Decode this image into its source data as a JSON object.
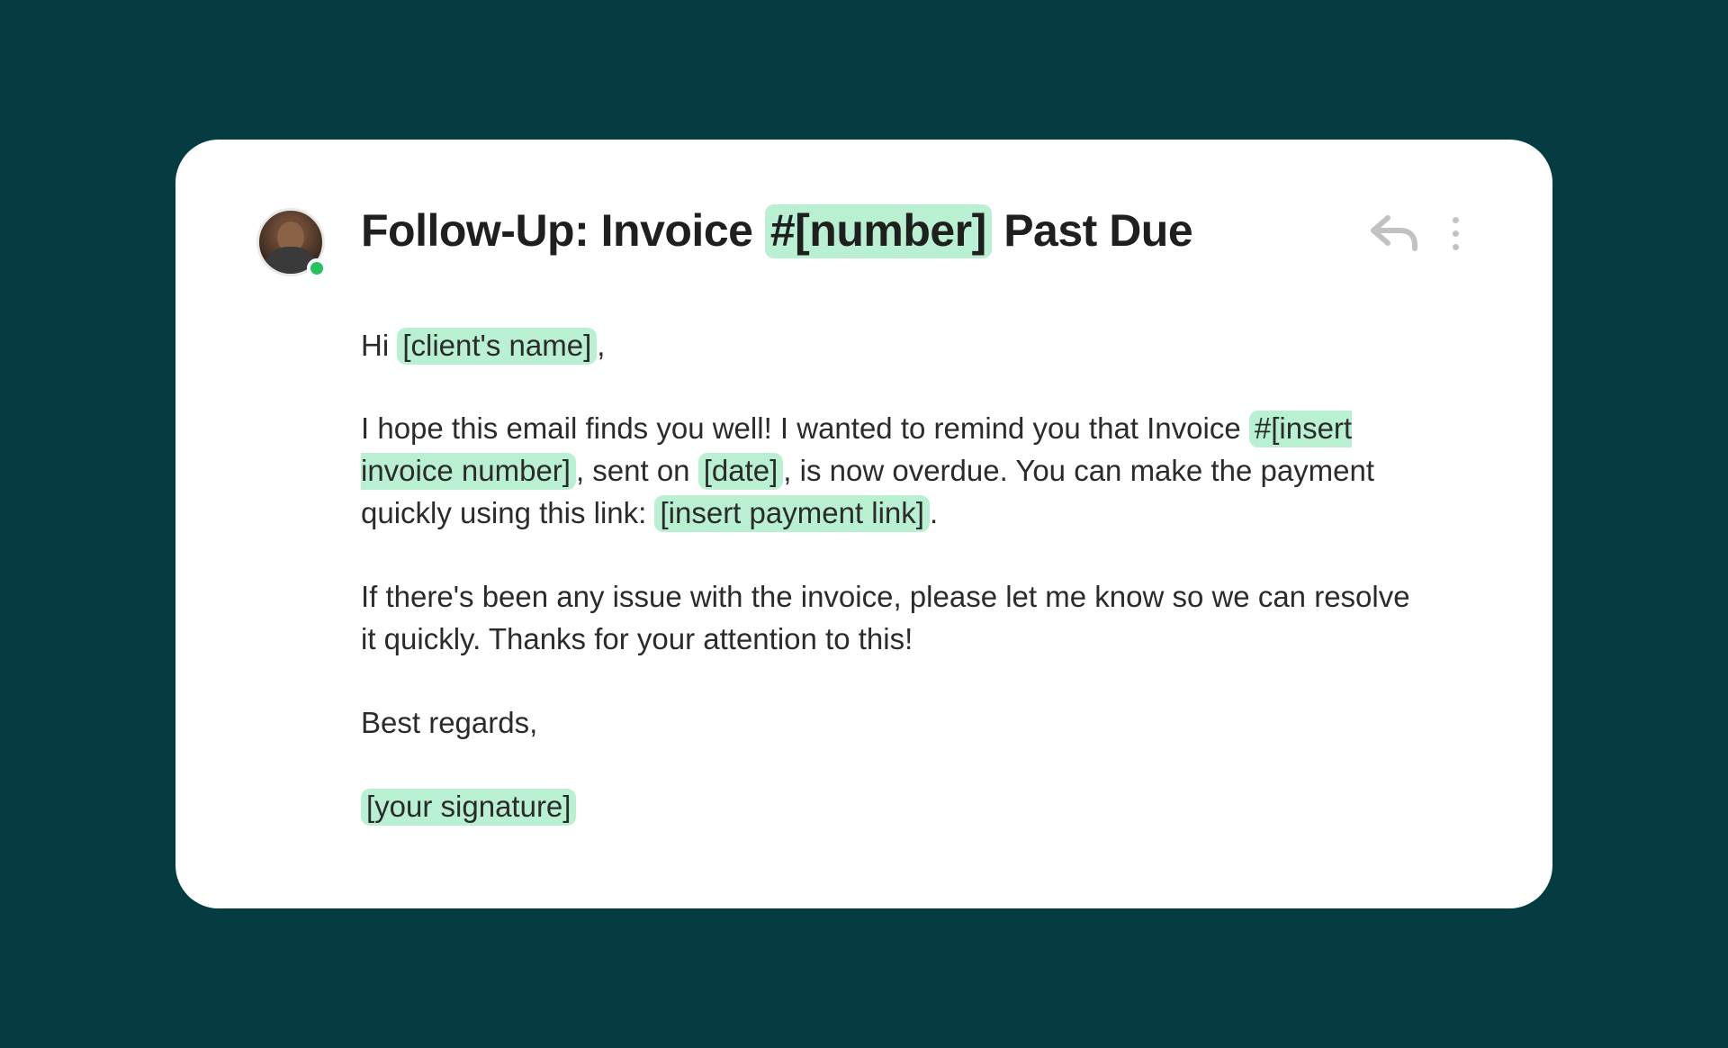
{
  "subject": {
    "pre": "Follow-Up: Invoice ",
    "placeholder": "#[number]",
    "post": " Past Due"
  },
  "greeting": {
    "pre": "Hi ",
    "placeholder": "[client's name]",
    "post": ","
  },
  "para1": {
    "t1": "I hope this email finds you well! I wanted to remind you that Invoice ",
    "p1": "#[insert invoice number]",
    "t2": ", sent on ",
    "p2": "[date]",
    "t3": ", is now overdue. You can make the payment quickly using this link: ",
    "p3": "[insert payment link]",
    "t4": "."
  },
  "para2": "If there's been any issue with the invoice, please let me know so we can resolve it quickly. Thanks for your attention to this!",
  "signoff": "Best regards,",
  "signature": "[your signature]",
  "status": {
    "online": true
  },
  "colors": {
    "highlight": "#b8f0d1",
    "background": "#053c42"
  }
}
